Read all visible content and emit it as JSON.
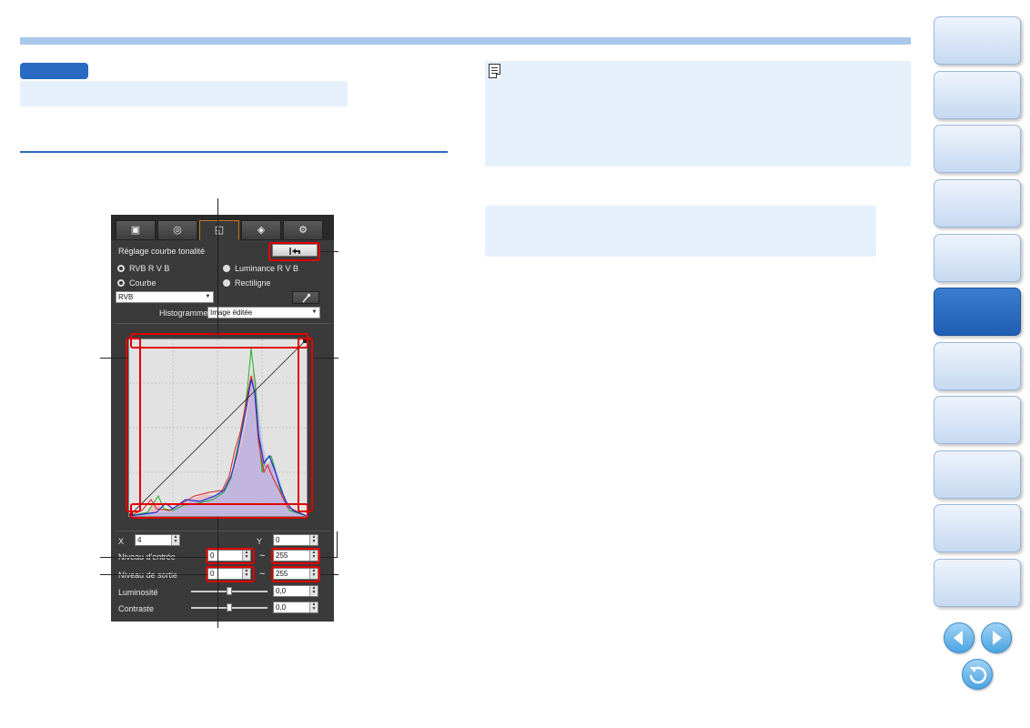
{
  "panel": {
    "tabs": [
      {
        "icon": "image-adjust-icon",
        "glyph": "▣"
      },
      {
        "icon": "color-adjust-icon",
        "glyph": "◎"
      },
      {
        "icon": "tone-curve-icon",
        "glyph": "◱"
      },
      {
        "icon": "lens-aberration-icon",
        "glyph": "◈"
      },
      {
        "icon": "settings-gear-icon",
        "glyph": "⚙"
      }
    ],
    "section_title": "Réglage courbe tonalité",
    "reset_icon": "reset-arrow-icon",
    "mode_rgb": "RVB R V B",
    "mode_luminance": "Luminance R V B",
    "curve": "Courbe",
    "linear": "Rectiligne",
    "channel_value": "RVB",
    "eyedropper_icon": "eyedropper-icon",
    "histogram_label": "Histogramme",
    "histogram_value": "Image éditée",
    "x_label": "X",
    "x_value": "4",
    "y_label": "Y",
    "y_value": "0",
    "input_label": "Niveau d'entrée",
    "input_min": "0",
    "input_max": "255",
    "output_label": "Niveau de sortie",
    "output_min": "0",
    "output_max": "255",
    "tilde": "~",
    "brightness_label": "Luminosité",
    "brightness_value": "0,0",
    "contrast_label": "Contraste",
    "contrast_value": "0,0"
  },
  "colors": {
    "accent": "#2a6ac2",
    "light_bar": "#a9c8ea",
    "box_bg": "#e6f0fb",
    "highlight": "#e10000",
    "nav_active": "#2568c0"
  },
  "nav": {
    "active_index": 5,
    "buttons": 11,
    "prev_icon": "previous-page-icon",
    "next_icon": "next-page-icon",
    "return_icon": "return-icon"
  }
}
